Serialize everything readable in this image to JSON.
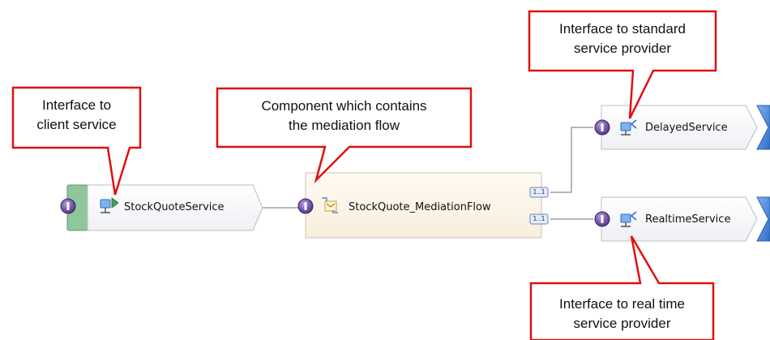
{
  "callouts": {
    "client": "Interface to\nclient service",
    "component": "Component which contains\nthe mediation flow",
    "standard": "Interface to standard\nservice provider",
    "realtime": "Interface to real time\nservice provider"
  },
  "nodes": {
    "export": "StockQuoteService",
    "mediation": "StockQuote_MediationFlow",
    "delayed": "DelayedService",
    "realtime": "RealtimeService"
  },
  "wires": {
    "top": "1..1",
    "bottom": "1..1"
  },
  "colors": {
    "callout_border": "#e01010",
    "interface_ball": "#6a4a9c",
    "export_bar": "#8fc79a",
    "import_arrow": "#3d7fd6",
    "component_fill": "#fdf6ec"
  },
  "icons": {
    "export": "service-export-icon",
    "mediation": "mediation-flow-icon",
    "import": "service-import-icon"
  }
}
